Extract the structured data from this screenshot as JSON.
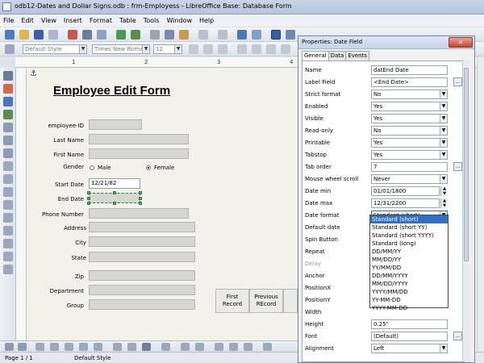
{
  "window": {
    "title": "odb12-Dates and Dollar Signs.odb : frm-Employess - LibreOffice Base: Database Form"
  },
  "menu": [
    "File",
    "Edit",
    "View",
    "Insert",
    "Format",
    "Table",
    "Tools",
    "Window",
    "Help"
  ],
  "format_bar": {
    "style": "Default Style",
    "font": "Times New Roman",
    "size": "12"
  },
  "ruler": [
    "1",
    "2",
    "3",
    "4",
    "5"
  ],
  "form": {
    "title": "Employee Edit Form",
    "labels": {
      "employee_id": "employee-ID",
      "last_name": "Last Name",
      "first_name": "First Name",
      "gender": "Gender",
      "start_date": "Start Date",
      "end_date": "End Date",
      "phone": "Phone Number",
      "address": "Address",
      "city": "City",
      "state": "State",
      "zip": "Zip",
      "department": "Department",
      "group": "Group"
    },
    "gender_options": {
      "male": "Male",
      "female": "Female"
    },
    "start_date_value": "12/21/82",
    "buttons": {
      "first": "First Record",
      "previous": "Previous REcord"
    }
  },
  "properties": {
    "title": "Properties: Date Field",
    "tabs": [
      "General",
      "Data",
      "Events"
    ],
    "rows": {
      "name": {
        "label": "Name",
        "value": "datEnd Date"
      },
      "label_field": {
        "label": "Label Field",
        "value": "<End Date>"
      },
      "strict_format": {
        "label": "Strict format",
        "value": "No"
      },
      "enabled": {
        "label": "Enabled",
        "value": "Yes"
      },
      "visible": {
        "label": "Visible",
        "value": "Yes"
      },
      "read_only": {
        "label": "Read-only",
        "value": "No"
      },
      "printable": {
        "label": "Printable",
        "value": "Yes"
      },
      "tabstop": {
        "label": "Tabstop",
        "value": "Yes"
      },
      "tab_order": {
        "label": "Tab order",
        "value": "7"
      },
      "mouse_wheel": {
        "label": "Mouse wheel scroll",
        "value": "Never"
      },
      "date_min": {
        "label": "Date min",
        "value": "01/01/1800"
      },
      "date_max": {
        "label": "Date max",
        "value": "12/31/2200"
      },
      "date_format": {
        "label": "Date format",
        "value": "Standard (short)"
      },
      "default_date": {
        "label": "Default date"
      },
      "spin_button": {
        "label": "Spin Button"
      },
      "repeat": {
        "label": "Repeat"
      },
      "delay": {
        "label": "Delay"
      },
      "anchor": {
        "label": "Anchor"
      },
      "position_x": {
        "label": "PositionX"
      },
      "position_y": {
        "label": "PositionY"
      },
      "width": {
        "label": "Width"
      },
      "height": {
        "label": "Height",
        "value": "0.25\""
      },
      "font": {
        "label": "Font",
        "value": "(Default)"
      },
      "alignment": {
        "label": "Alignment",
        "value": "Left"
      }
    },
    "date_format_options": [
      "Standard (short)",
      "Standard (short YY)",
      "Standard (short YYYY)",
      "Standard (long)",
      "DD/MM/YY",
      "MM/DD/YY",
      "YY/MM/DD",
      "DD/MM/YYYY",
      "MM/DD/YYYY",
      "YYYY/MM/DD",
      "YY-MM-DD",
      "YYYY-MM-DD"
    ],
    "dots": "..."
  },
  "status": {
    "page": "Page 1 / 1",
    "style": "Default Style"
  }
}
